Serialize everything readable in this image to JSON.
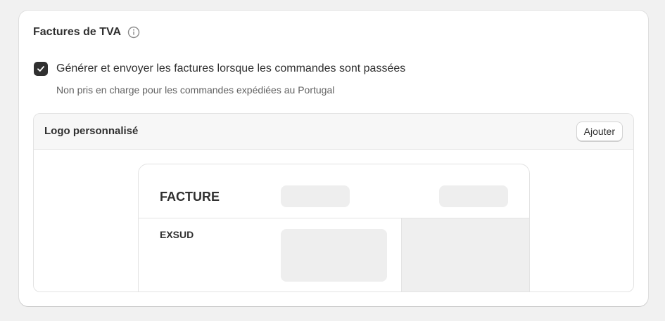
{
  "vat_invoices": {
    "title": "Factures de TVA",
    "info_icon": "info-circle-icon",
    "checkbox": {
      "checked": true,
      "label": "Générer et envoyer les factures lorsque les commandes sont passées",
      "help_text": "Non pris en charge pour les commandes expédiées au Portugal"
    }
  },
  "custom_logo": {
    "title": "Logo personnalisé",
    "add_button_label": "Ajouter"
  },
  "invoice_preview": {
    "heading": "FACTURE",
    "shop_name": "EXSUD"
  },
  "colors": {
    "checkbox_fill": "#303030",
    "card_background": "#ffffff",
    "page_background": "#f1f1f1",
    "placeholder": "#eeeeee"
  }
}
